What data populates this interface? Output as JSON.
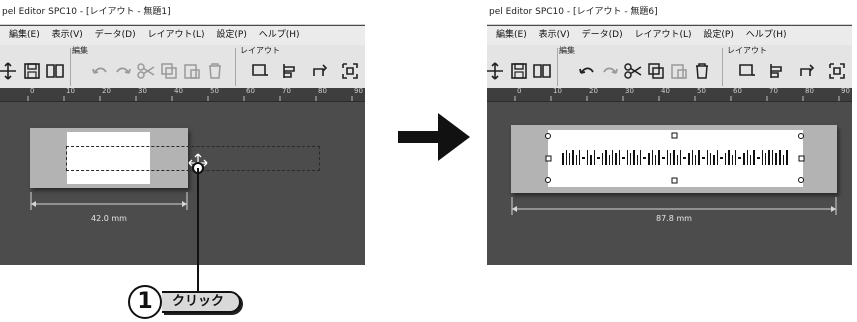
{
  "left_panel": {
    "title": "pel Editor SPC10 - [レイアウト - 無題1]",
    "menu": [
      "編集(E)",
      "表示(V)",
      "データ(D)",
      "レイアウト(L)",
      "設定(P)",
      "ヘルプ(H)"
    ],
    "toolbar_groups": {
      "edit": "編集",
      "layout": "レイアウト"
    },
    "ruler_ticks": [
      "0",
      "10",
      "20",
      "30",
      "40",
      "50",
      "60",
      "70",
      "80",
      "90"
    ],
    "dimension_label": "42.0 mm"
  },
  "right_panel": {
    "title": "pel Editor SPC10 - [レイアウト - 無題6]",
    "menu": [
      "編集(E)",
      "表示(V)",
      "データ(D)",
      "レイアウト(L)",
      "設定(P)",
      "ヘルプ(H)"
    ],
    "toolbar_groups": {
      "edit": "編集",
      "layout": "レイアウト"
    },
    "ruler_ticks": [
      "0",
      "10",
      "20",
      "30",
      "40",
      "50",
      "60",
      "70",
      "80",
      "90"
    ],
    "dimension_label": "87.8 mm"
  },
  "callout": {
    "number": "1",
    "text": "クリック"
  },
  "colors": {
    "canvas": "#4c4c4c",
    "label_tape": "#b3b3b3",
    "arrow": "#111111"
  },
  "icons": [
    "move-icon",
    "save-icon",
    "book-icon",
    "undo-icon",
    "redo-icon",
    "cut-icon",
    "copy-icon",
    "paste-icon",
    "delete-icon",
    "layout-icon",
    "align-icon",
    "rotate-icon",
    "frame-icon",
    "move-cursor-icon"
  ]
}
